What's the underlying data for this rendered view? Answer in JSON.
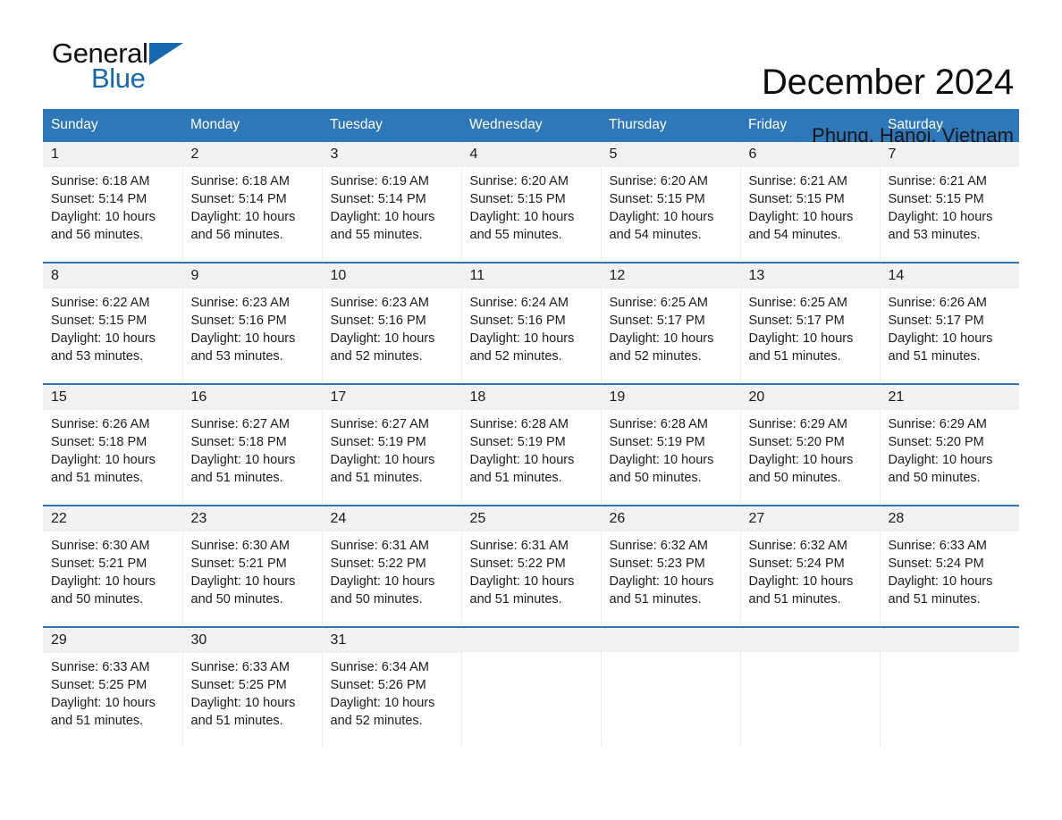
{
  "brand": {
    "name_part1": "General",
    "name_part2": "Blue",
    "triangle_color": "#1567ae"
  },
  "header": {
    "title": "December 2024",
    "subtitle": "Phung, Hanoi, Vietnam",
    "header_bg_color": "#2e77b8",
    "header_text_color": "#ffffff",
    "daynum_bg_color": "#f1f1f1"
  },
  "weekday_headers": [
    "Sunday",
    "Monday",
    "Tuesday",
    "Wednesday",
    "Thursday",
    "Friday",
    "Saturday"
  ],
  "weeks": [
    [
      {
        "day": "1",
        "sunrise": "Sunrise: 6:18 AM",
        "sunset": "Sunset: 5:14 PM",
        "daylight": "Daylight: 10 hours and 56 minutes."
      },
      {
        "day": "2",
        "sunrise": "Sunrise: 6:18 AM",
        "sunset": "Sunset: 5:14 PM",
        "daylight": "Daylight: 10 hours and 56 minutes."
      },
      {
        "day": "3",
        "sunrise": "Sunrise: 6:19 AM",
        "sunset": "Sunset: 5:14 PM",
        "daylight": "Daylight: 10 hours and 55 minutes."
      },
      {
        "day": "4",
        "sunrise": "Sunrise: 6:20 AM",
        "sunset": "Sunset: 5:15 PM",
        "daylight": "Daylight: 10 hours and 55 minutes."
      },
      {
        "day": "5",
        "sunrise": "Sunrise: 6:20 AM",
        "sunset": "Sunset: 5:15 PM",
        "daylight": "Daylight: 10 hours and 54 minutes."
      },
      {
        "day": "6",
        "sunrise": "Sunrise: 6:21 AM",
        "sunset": "Sunset: 5:15 PM",
        "daylight": "Daylight: 10 hours and 54 minutes."
      },
      {
        "day": "7",
        "sunrise": "Sunrise: 6:21 AM",
        "sunset": "Sunset: 5:15 PM",
        "daylight": "Daylight: 10 hours and 53 minutes."
      }
    ],
    [
      {
        "day": "8",
        "sunrise": "Sunrise: 6:22 AM",
        "sunset": "Sunset: 5:15 PM",
        "daylight": "Daylight: 10 hours and 53 minutes."
      },
      {
        "day": "9",
        "sunrise": "Sunrise: 6:23 AM",
        "sunset": "Sunset: 5:16 PM",
        "daylight": "Daylight: 10 hours and 53 minutes."
      },
      {
        "day": "10",
        "sunrise": "Sunrise: 6:23 AM",
        "sunset": "Sunset: 5:16 PM",
        "daylight": "Daylight: 10 hours and 52 minutes."
      },
      {
        "day": "11",
        "sunrise": "Sunrise: 6:24 AM",
        "sunset": "Sunset: 5:16 PM",
        "daylight": "Daylight: 10 hours and 52 minutes."
      },
      {
        "day": "12",
        "sunrise": "Sunrise: 6:25 AM",
        "sunset": "Sunset: 5:17 PM",
        "daylight": "Daylight: 10 hours and 52 minutes."
      },
      {
        "day": "13",
        "sunrise": "Sunrise: 6:25 AM",
        "sunset": "Sunset: 5:17 PM",
        "daylight": "Daylight: 10 hours and 51 minutes."
      },
      {
        "day": "14",
        "sunrise": "Sunrise: 6:26 AM",
        "sunset": "Sunset: 5:17 PM",
        "daylight": "Daylight: 10 hours and 51 minutes."
      }
    ],
    [
      {
        "day": "15",
        "sunrise": "Sunrise: 6:26 AM",
        "sunset": "Sunset: 5:18 PM",
        "daylight": "Daylight: 10 hours and 51 minutes."
      },
      {
        "day": "16",
        "sunrise": "Sunrise: 6:27 AM",
        "sunset": "Sunset: 5:18 PM",
        "daylight": "Daylight: 10 hours and 51 minutes."
      },
      {
        "day": "17",
        "sunrise": "Sunrise: 6:27 AM",
        "sunset": "Sunset: 5:19 PM",
        "daylight": "Daylight: 10 hours and 51 minutes."
      },
      {
        "day": "18",
        "sunrise": "Sunrise: 6:28 AM",
        "sunset": "Sunset: 5:19 PM",
        "daylight": "Daylight: 10 hours and 51 minutes."
      },
      {
        "day": "19",
        "sunrise": "Sunrise: 6:28 AM",
        "sunset": "Sunset: 5:19 PM",
        "daylight": "Daylight: 10 hours and 50 minutes."
      },
      {
        "day": "20",
        "sunrise": "Sunrise: 6:29 AM",
        "sunset": "Sunset: 5:20 PM",
        "daylight": "Daylight: 10 hours and 50 minutes."
      },
      {
        "day": "21",
        "sunrise": "Sunrise: 6:29 AM",
        "sunset": "Sunset: 5:20 PM",
        "daylight": "Daylight: 10 hours and 50 minutes."
      }
    ],
    [
      {
        "day": "22",
        "sunrise": "Sunrise: 6:30 AM",
        "sunset": "Sunset: 5:21 PM",
        "daylight": "Daylight: 10 hours and 50 minutes."
      },
      {
        "day": "23",
        "sunrise": "Sunrise: 6:30 AM",
        "sunset": "Sunset: 5:21 PM",
        "daylight": "Daylight: 10 hours and 50 minutes."
      },
      {
        "day": "24",
        "sunrise": "Sunrise: 6:31 AM",
        "sunset": "Sunset: 5:22 PM",
        "daylight": "Daylight: 10 hours and 50 minutes."
      },
      {
        "day": "25",
        "sunrise": "Sunrise: 6:31 AM",
        "sunset": "Sunset: 5:22 PM",
        "daylight": "Daylight: 10 hours and 51 minutes."
      },
      {
        "day": "26",
        "sunrise": "Sunrise: 6:32 AM",
        "sunset": "Sunset: 5:23 PM",
        "daylight": "Daylight: 10 hours and 51 minutes."
      },
      {
        "day": "27",
        "sunrise": "Sunrise: 6:32 AM",
        "sunset": "Sunset: 5:24 PM",
        "daylight": "Daylight: 10 hours and 51 minutes."
      },
      {
        "day": "28",
        "sunrise": "Sunrise: 6:33 AM",
        "sunset": "Sunset: 5:24 PM",
        "daylight": "Daylight: 10 hours and 51 minutes."
      }
    ],
    [
      {
        "day": "29",
        "sunrise": "Sunrise: 6:33 AM",
        "sunset": "Sunset: 5:25 PM",
        "daylight": "Daylight: 10 hours and 51 minutes."
      },
      {
        "day": "30",
        "sunrise": "Sunrise: 6:33 AM",
        "sunset": "Sunset: 5:25 PM",
        "daylight": "Daylight: 10 hours and 51 minutes."
      },
      {
        "day": "31",
        "sunrise": "Sunrise: 6:34 AM",
        "sunset": "Sunset: 5:26 PM",
        "daylight": "Daylight: 10 hours and 52 minutes."
      },
      {
        "day": "",
        "sunrise": "",
        "sunset": "",
        "daylight": ""
      },
      {
        "day": "",
        "sunrise": "",
        "sunset": "",
        "daylight": ""
      },
      {
        "day": "",
        "sunrise": "",
        "sunset": "",
        "daylight": ""
      },
      {
        "day": "",
        "sunrise": "",
        "sunset": "",
        "daylight": ""
      }
    ]
  ]
}
